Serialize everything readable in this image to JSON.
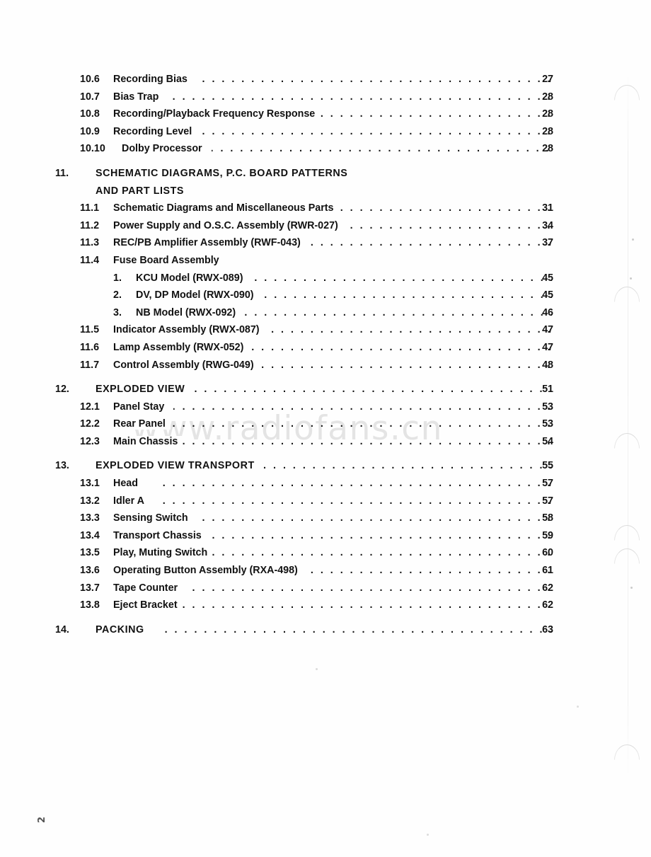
{
  "document": {
    "folio": "2",
    "watermark": "www.radiofans.cn"
  },
  "toc": {
    "entries": [
      {
        "level": 2,
        "number": "10.6",
        "label": "Recording Bias",
        "page": "27"
      },
      {
        "level": 2,
        "number": "10.7",
        "label": "Bias Trap",
        "page": "28"
      },
      {
        "level": 2,
        "number": "10.8",
        "label": "Recording/Playback Frequency Response",
        "page": "28"
      },
      {
        "level": 2,
        "number": "10.9",
        "label": "Recording Level",
        "page": "28"
      },
      {
        "level": 2,
        "number": "10.10",
        "label": "Dolby Processor",
        "page": "28"
      },
      {
        "level": 1,
        "number": "11.",
        "label": "SCHEMATIC DIAGRAMS, P.C. BOARD PATTERNS",
        "continuation": "AND PART LISTS",
        "page": ""
      },
      {
        "level": 2,
        "number": "11.1",
        "label": "Schematic Diagrams and Miscellaneous Parts",
        "page": "31"
      },
      {
        "level": 2,
        "number": "11.2",
        "label": "Power Supply and O.S.C. Assembly (RWR-027)",
        "page": "34"
      },
      {
        "level": 2,
        "number": "11.3",
        "label": "REC/PB Amplifier Assembly (RWF-043)",
        "page": "37"
      },
      {
        "level": 2,
        "number": "11.4",
        "label": "Fuse Board Assembly",
        "page": ""
      },
      {
        "level": 3,
        "number": "1.",
        "label": "KCU Model (RWX-089)",
        "page": "45"
      },
      {
        "level": 3,
        "number": "2.",
        "label": "DV, DP Model (RWX-090)",
        "page": "45"
      },
      {
        "level": 3,
        "number": "3.",
        "label": "NB Model (RWX-092)",
        "page": "46"
      },
      {
        "level": 2,
        "number": "11.5",
        "label": "Indicator Assembly (RWX-087)",
        "page": "47"
      },
      {
        "level": 2,
        "number": "11.6",
        "label": "Lamp Assembly (RWX-052)",
        "page": "47"
      },
      {
        "level": 2,
        "number": "11.7",
        "label": "Control Assembly (RWG-049)",
        "page": "48"
      },
      {
        "level": 1,
        "number": "12.",
        "label": "EXPLODED VIEW",
        "page": "51"
      },
      {
        "level": 2,
        "number": "12.1",
        "label": "Panel Stay",
        "page": "53"
      },
      {
        "level": 2,
        "number": "12.2",
        "label": "Rear Panel",
        "page": "53"
      },
      {
        "level": 2,
        "number": "12.3",
        "label": "Main Chassis",
        "page": "54"
      },
      {
        "level": 1,
        "number": "13.",
        "label": "EXPLODED VIEW TRANSPORT",
        "page": "55"
      },
      {
        "level": 2,
        "number": "13.1",
        "label": "Head",
        "page": "57"
      },
      {
        "level": 2,
        "number": "13.2",
        "label": "Idler A",
        "page": "57"
      },
      {
        "level": 2,
        "number": "13.3",
        "label": "Sensing Switch",
        "page": "58"
      },
      {
        "level": 2,
        "number": "13.4",
        "label": "Transport Chassis",
        "page": "59"
      },
      {
        "level": 2,
        "number": "13.5",
        "label": "Play, Muting Switch",
        "page": "60"
      },
      {
        "level": 2,
        "number": "13.6",
        "label": "Operating Button Assembly (RXA-498)",
        "page": "61"
      },
      {
        "level": 2,
        "number": "13.7",
        "label": "Tape Counter",
        "page": "62"
      },
      {
        "level": 2,
        "number": "13.8",
        "label": "Eject Bracket",
        "page": "62"
      },
      {
        "level": 1,
        "number": "14.",
        "label": "PACKING",
        "page": "63"
      }
    ]
  }
}
